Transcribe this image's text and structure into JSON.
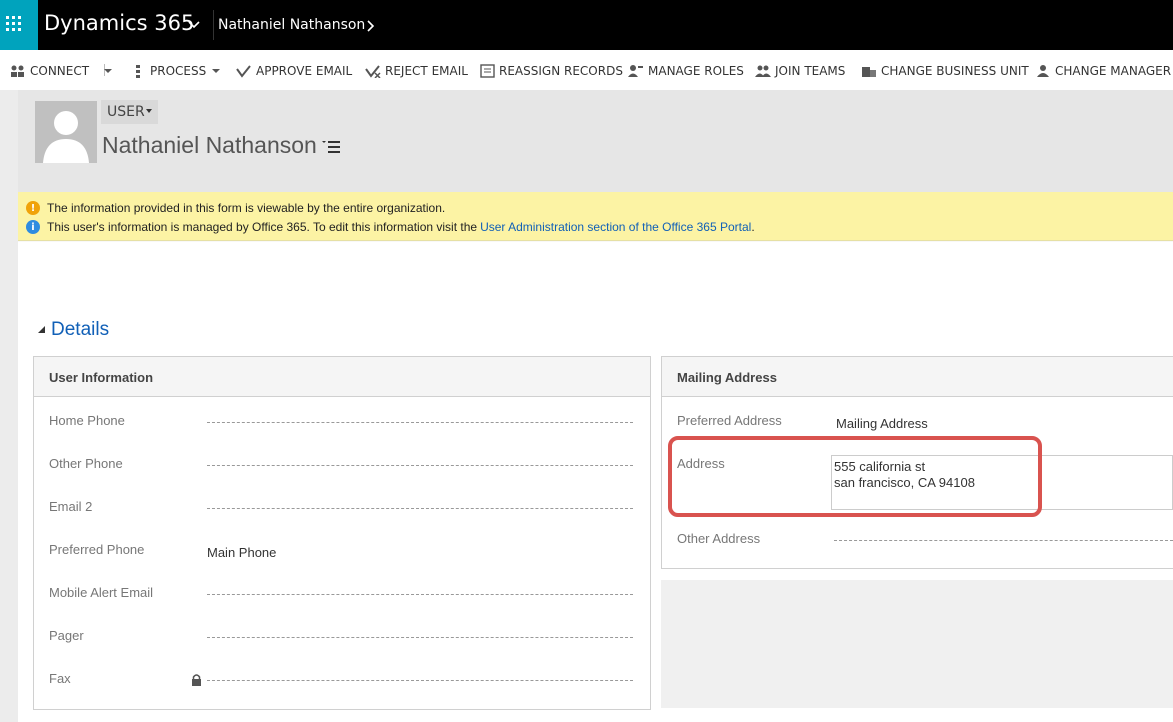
{
  "topbar": {
    "app_title": "Dynamics 365",
    "breadcrumb": "Nathaniel Nathanson",
    "accent_color": "#00a3bd"
  },
  "commands": {
    "connect": "CONNECT",
    "process": "PROCESS",
    "approve_email": "APPROVE EMAIL",
    "reject_email": "REJECT EMAIL",
    "reassign_records": "REASSIGN RECORDS",
    "manage_roles": "MANAGE ROLES",
    "join_teams": "JOIN TEAMS",
    "change_business_unit": "CHANGE BUSINESS UNIT",
    "change_manager": "CHANGE MANAGER"
  },
  "header": {
    "entity": "USER",
    "record_name": "Nathaniel Nathanson"
  },
  "notifications": {
    "warning": "The information provided in this form is viewable by the entire organization.",
    "info": "This user's information is managed by Office 365. To edit this information visit the",
    "info_link": "User Administration section of the Office 365 Portal",
    "info_end": "."
  },
  "details": {
    "title": "Details",
    "user_information": {
      "title": "User Information",
      "fields": [
        {
          "label": "Home Phone",
          "value": ""
        },
        {
          "label": "Other Phone",
          "value": ""
        },
        {
          "label": "Email 2",
          "value": ""
        },
        {
          "label": "Preferred Phone",
          "value": "Main Phone"
        },
        {
          "label": "Mobile Alert Email",
          "value": ""
        },
        {
          "label": "Pager",
          "value": ""
        },
        {
          "label": "Fax",
          "value": "",
          "locked": true
        }
      ]
    },
    "mailing_address": {
      "title": "Mailing Address",
      "preferred_address_label": "Preferred Address",
      "preferred_address_value": "Mailing Address",
      "address_label": "Address",
      "address_line1": "555 california st",
      "address_line2": "san francisco, CA 94108",
      "other_address_label": "Other Address",
      "highlight_color": "#d9534f"
    }
  }
}
